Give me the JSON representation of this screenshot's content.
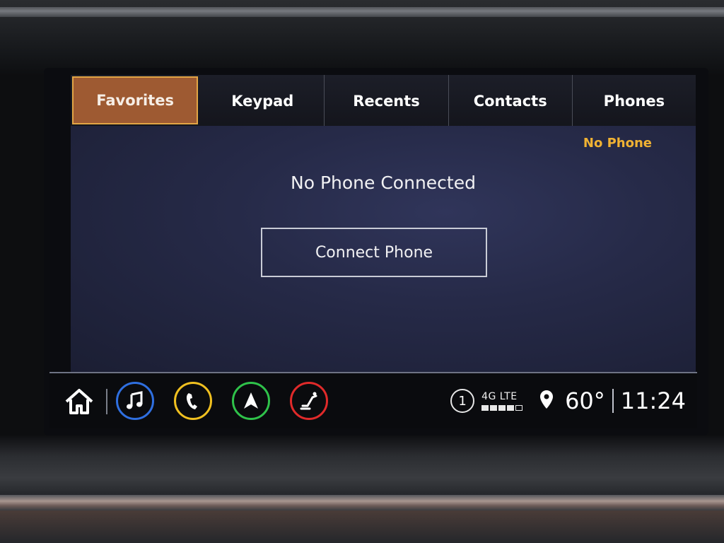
{
  "tabs": [
    {
      "label": "Favorites",
      "active": true
    },
    {
      "label": "Keypad",
      "active": false
    },
    {
      "label": "Recents",
      "active": false
    },
    {
      "label": "Contacts",
      "active": false
    },
    {
      "label": "Phones",
      "active": false
    }
  ],
  "phone_status": "No Phone",
  "main": {
    "headline": "No Phone Connected",
    "connect_button": "Connect Phone"
  },
  "bottom_bar": {
    "apps": [
      {
        "icon": "music-note-icon",
        "color": "#2f6fe0"
      },
      {
        "icon": "phone-icon",
        "color": "#f0c020"
      },
      {
        "icon": "navigation-arrow-icon",
        "color": "#2fc24a"
      },
      {
        "icon": "seat-icon",
        "color": "#e02a2a"
      }
    ],
    "sim_slot": "1",
    "network": "4G LTE",
    "signal_level": 4,
    "signal_max": 5,
    "temperature": "60°",
    "time": "11:24"
  },
  "colors": {
    "accent": "#f0b233",
    "active_tab": "#9e5a32"
  }
}
